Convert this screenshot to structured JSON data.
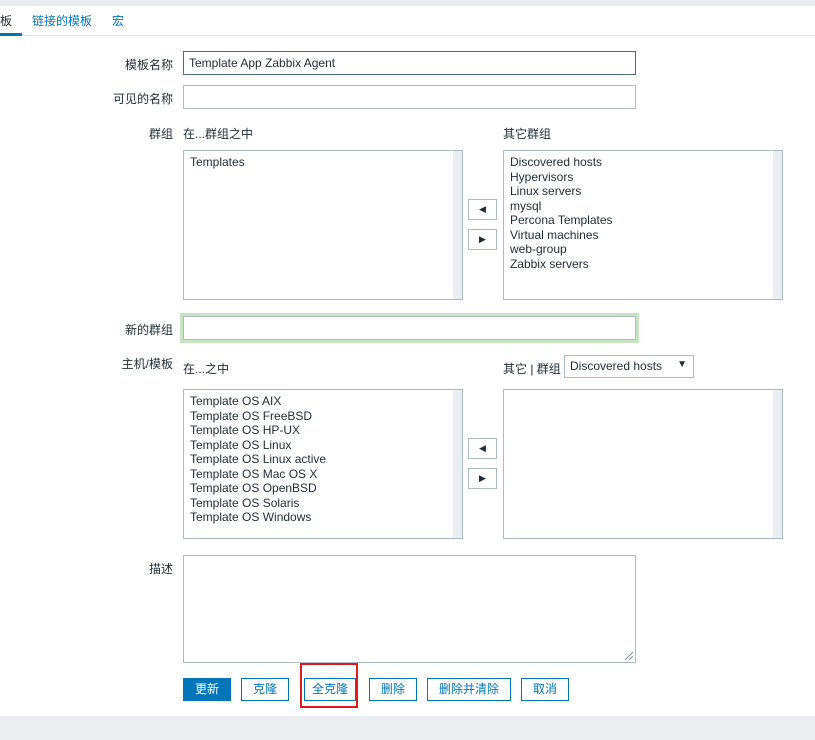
{
  "tabs": [
    "板",
    "链接的模板",
    "宏"
  ],
  "form": {
    "template_name_label": "模板名称",
    "template_name_value": "Template App Zabbix Agent",
    "visible_name_label": "可见的名称",
    "visible_name_value": "",
    "groups_label": "群组",
    "groups_in_label": "在...群组之中",
    "groups_other_label": "其它群组",
    "groups_in": [
      "Templates"
    ],
    "groups_other": [
      "Discovered hosts",
      "Hypervisors",
      "Linux servers",
      "mysql",
      "Percona Templates",
      "Virtual machines",
      "web-group",
      "Zabbix servers"
    ],
    "move_left_symbol": "◀",
    "move_right_symbol": "▶",
    "new_group_label": "新的群组",
    "new_group_value": "",
    "hosts_label": "主机/模板",
    "hosts_in_label": "在...之中",
    "hosts_other_label": "其它 | 群组",
    "hosts_group_selected": "Discovered hosts",
    "hosts_in": [
      "Template OS AIX",
      "Template OS FreeBSD",
      "Template OS HP-UX",
      "Template OS Linux",
      "Template OS Linux active",
      "Template OS Mac OS X",
      "Template OS OpenBSD",
      "Template OS Solaris",
      "Template OS Windows"
    ],
    "hosts_other": [],
    "description_label": "描述",
    "description_value": ""
  },
  "buttons": {
    "update": "更新",
    "clone": "克隆",
    "full_clone": "全克隆",
    "delete": "删除",
    "delete_clear": "删除并清除",
    "cancel": "取消"
  },
  "colors": {
    "accent": "#0275b8",
    "highlight": "#e0191f",
    "focus_ring": "#c6e4c2"
  }
}
